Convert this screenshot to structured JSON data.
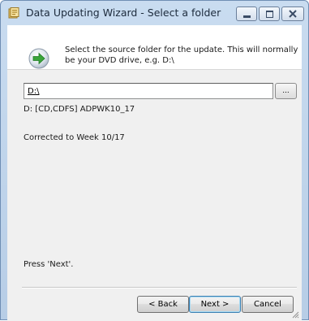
{
  "window": {
    "title": "Data Updating Wizard - Select a folder"
  },
  "header": {
    "instruction": "Select the source folder for the update. This will normally be your DVD drive, e.g. D:\\"
  },
  "folder": {
    "path_value": "D:\\",
    "browse_label": "..."
  },
  "drive_info": "D: [CD,CDFS] ADPWK10_17",
  "corrected_info": "Corrected to Week 10/17",
  "hint": "Press 'Next'.",
  "buttons": {
    "back_label": "< Back",
    "next_label": "Next >",
    "cancel_label": "Cancel"
  },
  "icons": {
    "title": "wizard-app-icon",
    "header": "green-arrow-disc-icon",
    "minimize": "minimize-icon",
    "maximize": "maximize-icon",
    "close": "close-icon",
    "grip": "resize-grip-icon"
  },
  "colors": {
    "close_red": "#c9483b",
    "accent_green": "#3aa53a",
    "default_button_border": "#3c7fb1"
  }
}
